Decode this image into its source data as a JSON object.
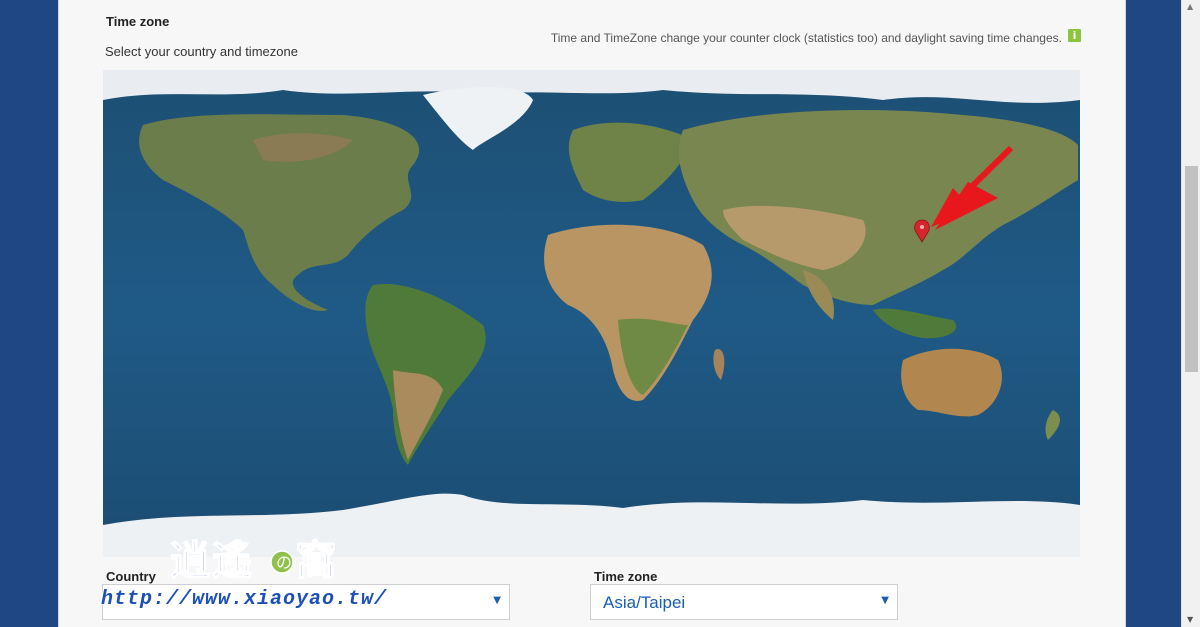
{
  "section": {
    "title": "Time zone",
    "subtitle": "Select your country and timezone",
    "note": "Time and TimeZone change your counter clock (statistics too) and daylight saving time changes.",
    "info_icon": "i"
  },
  "map": {
    "marker_icon": "map-pin-icon",
    "arrow_color": "#e8171c",
    "marker_color": "#d6262b"
  },
  "country": {
    "label": "Country",
    "value": ""
  },
  "timezone": {
    "label": "Time zone",
    "value": "Asia/Taipei"
  },
  "caret": "▼",
  "scrollbar": {
    "up": "▲",
    "down": "▼"
  },
  "watermark": {
    "brand": "逍遙の窩",
    "url": "http://www.xiaoyao.tw/"
  }
}
